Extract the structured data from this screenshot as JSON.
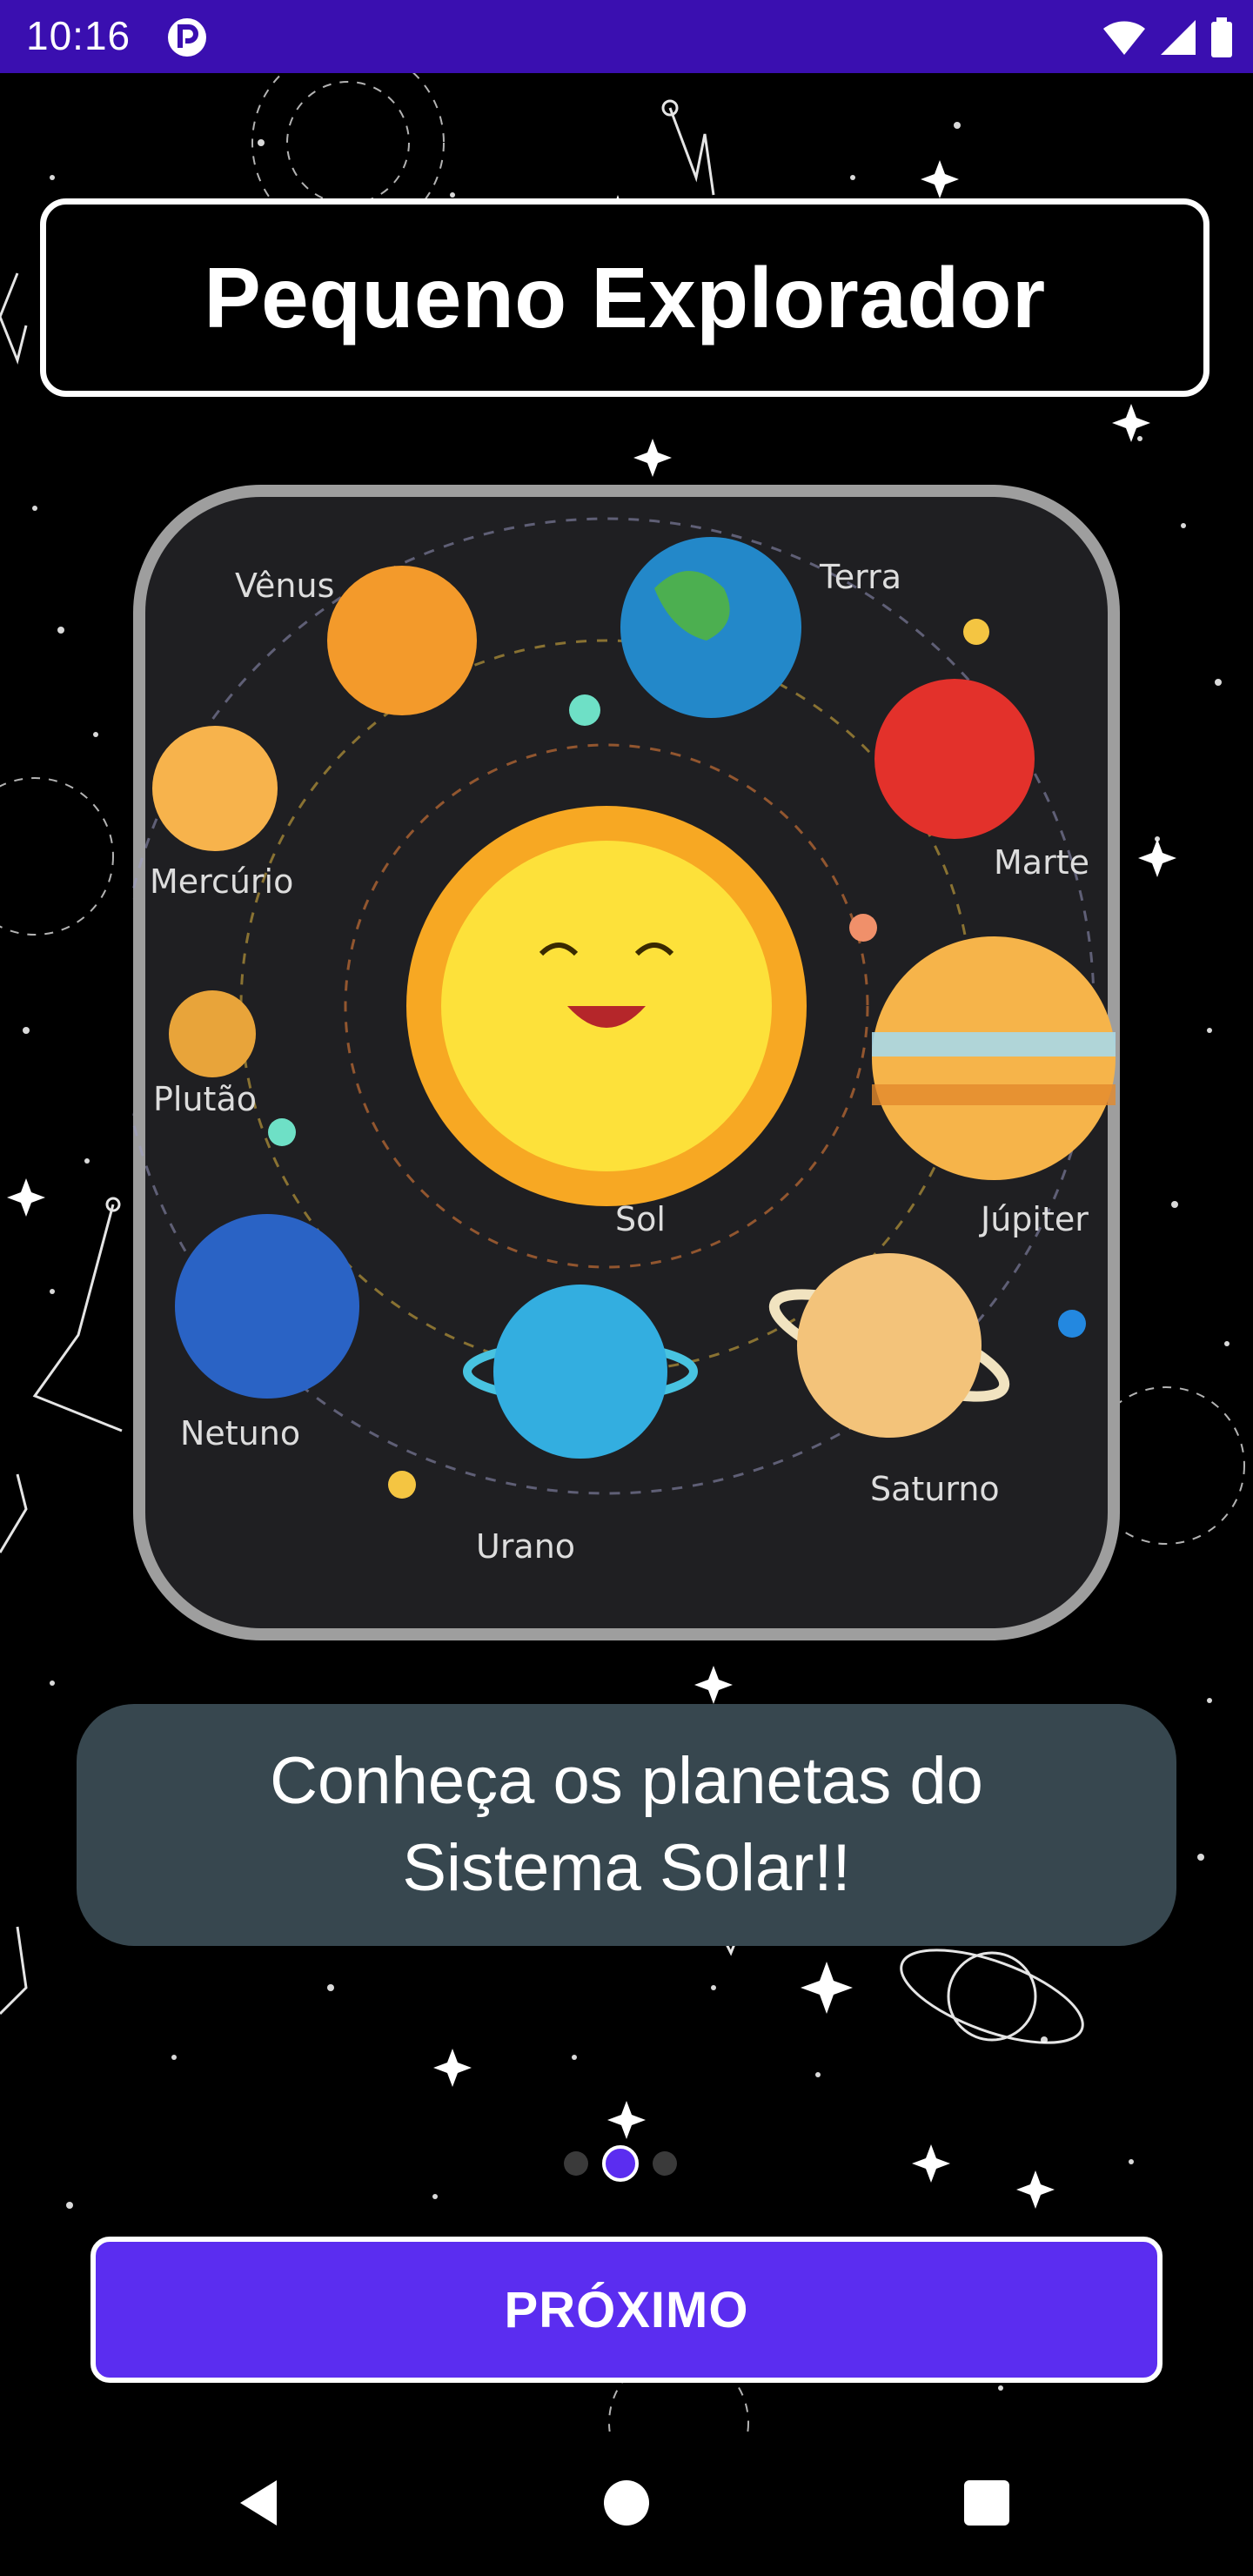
{
  "status_bar": {
    "time": "10:16",
    "background_color": "#3a0fb0",
    "icons": [
      "app-notification-icon",
      "wifi-icon",
      "signal-icon",
      "battery-icon"
    ]
  },
  "header": {
    "title": "Pequeno Explorador"
  },
  "illustration": {
    "labels": {
      "venus": "Vênus",
      "terra": "Terra",
      "marte": "Marte",
      "mercurio": "Mercúrio",
      "plutao": "Plutão",
      "sol": "Sol",
      "jupiter": "Júpiter",
      "netuno": "Netuno",
      "urano": "Urano",
      "saturno": "Saturno"
    }
  },
  "message": {
    "text": "Conheça os planetas do Sistema Solar!!"
  },
  "pager": {
    "total_pages": 3,
    "current_page": 2,
    "active_color": "#5b2df0"
  },
  "buttons": {
    "next_label": "PRÓXIMO"
  },
  "navigation": {
    "icons": [
      "back-icon",
      "home-icon",
      "recents-icon"
    ]
  },
  "colors": {
    "accent": "#5b2df0",
    "bubble": "#37474f"
  }
}
